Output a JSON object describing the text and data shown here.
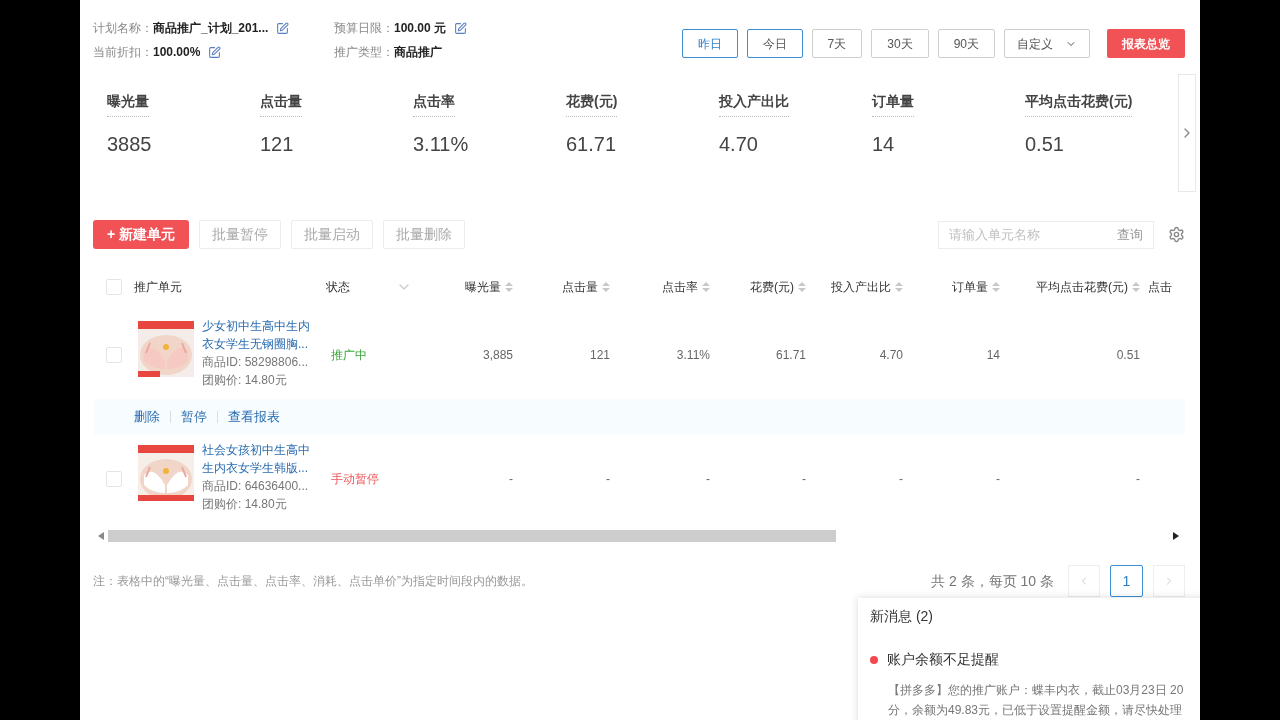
{
  "plan_info": [
    {
      "label": "计划名称：",
      "value": "商品推广_计划_201...",
      "editable": true
    },
    {
      "label": "预算日限：",
      "value": "100.00 元",
      "editable": true
    },
    {
      "label": "当前折扣：",
      "value": "100.00%",
      "editable": true
    },
    {
      "label": "推广类型：",
      "value": "商品推广",
      "editable": false
    }
  ],
  "date_ranges": [
    {
      "label": "昨日",
      "selected": true,
      "hovered": false
    },
    {
      "label": "今日",
      "selected": false,
      "hovered": true
    },
    {
      "label": "7天",
      "selected": false,
      "hovered": false
    },
    {
      "label": "30天",
      "selected": false,
      "hovered": false
    },
    {
      "label": "90天",
      "selected": false,
      "hovered": false
    }
  ],
  "custom_range": {
    "label": "自定义"
  },
  "report_button": "报表总览",
  "metrics": [
    {
      "label": "曝光量",
      "value": "3885"
    },
    {
      "label": "点击量",
      "value": "121"
    },
    {
      "label": "点击率",
      "value": "3.11%"
    },
    {
      "label": "花费(元)",
      "value": "61.71"
    },
    {
      "label": "投入产出比",
      "value": "4.70"
    },
    {
      "label": "订单量",
      "value": "14"
    },
    {
      "label": "平均点击花费(元)",
      "value": "0.51"
    }
  ],
  "toolbar": {
    "new_button": "+ 新建单元",
    "batch_buttons": [
      "批量暂停",
      "批量启动",
      "批量删除"
    ],
    "search": {
      "placeholder": "请输入单元名称",
      "button": "查询"
    }
  },
  "table": {
    "header_checked": false,
    "columns": [
      {
        "label": "推广单元",
        "kind": "plain"
      },
      {
        "label": "状态",
        "kind": "filter"
      },
      {
        "label": "曝光量",
        "kind": "sort"
      },
      {
        "label": "点击量",
        "kind": "sort"
      },
      {
        "label": "点击率",
        "kind": "sort"
      },
      {
        "label": "花费(元)",
        "kind": "sort"
      },
      {
        "label": "投入产出比",
        "kind": "sort"
      },
      {
        "label": "订单量",
        "kind": "sort"
      },
      {
        "label": "平均点击花费(元)",
        "kind": "sort"
      },
      {
        "label": "点击",
        "kind": "plain"
      }
    ],
    "rows": [
      {
        "checked": false,
        "title": [
          "少女初中生高中生内",
          "衣女学生无钢圈胸..."
        ],
        "product_id": "商品ID: 58298806...",
        "price": "团购价: 14.80元",
        "status": "推广中",
        "kind": "active",
        "values": [
          "3,885",
          "121",
          "3.11%",
          "61.71",
          "4.70",
          "14",
          "0.51"
        ],
        "actions": [
          "删除",
          "暂停",
          "查看报表"
        ]
      },
      {
        "checked": false,
        "title": [
          "社会女孩初中生高中",
          "生内衣女学生韩版..."
        ],
        "product_id": "商品ID: 64636400...",
        "price": "团购价: 14.80元",
        "status": "手动暂停",
        "kind": "paused",
        "values": [
          "-",
          "-",
          "-",
          "-",
          "-",
          "-",
          "-"
        ]
      }
    ]
  },
  "note": "注：表格中的“曝光量、点击量、点击率、消耗、点击单价”为指定时间段内的数据。",
  "pagination": {
    "summary": "共 2 条，每页 10 条",
    "pages": [
      {
        "label": "1",
        "selected": true
      }
    ]
  },
  "messages": {
    "title": "新消息 (2)",
    "items": [
      {
        "title": "账户余额不足提醒",
        "color": "#f5474e",
        "lines": [
          "【拼多多】您的推广账户：蝶丰内衣，截止03月23日 20",
          "分，余额为49.83元，已低于设置提醒金额，请尽快处理"
        ]
      }
    ]
  }
}
